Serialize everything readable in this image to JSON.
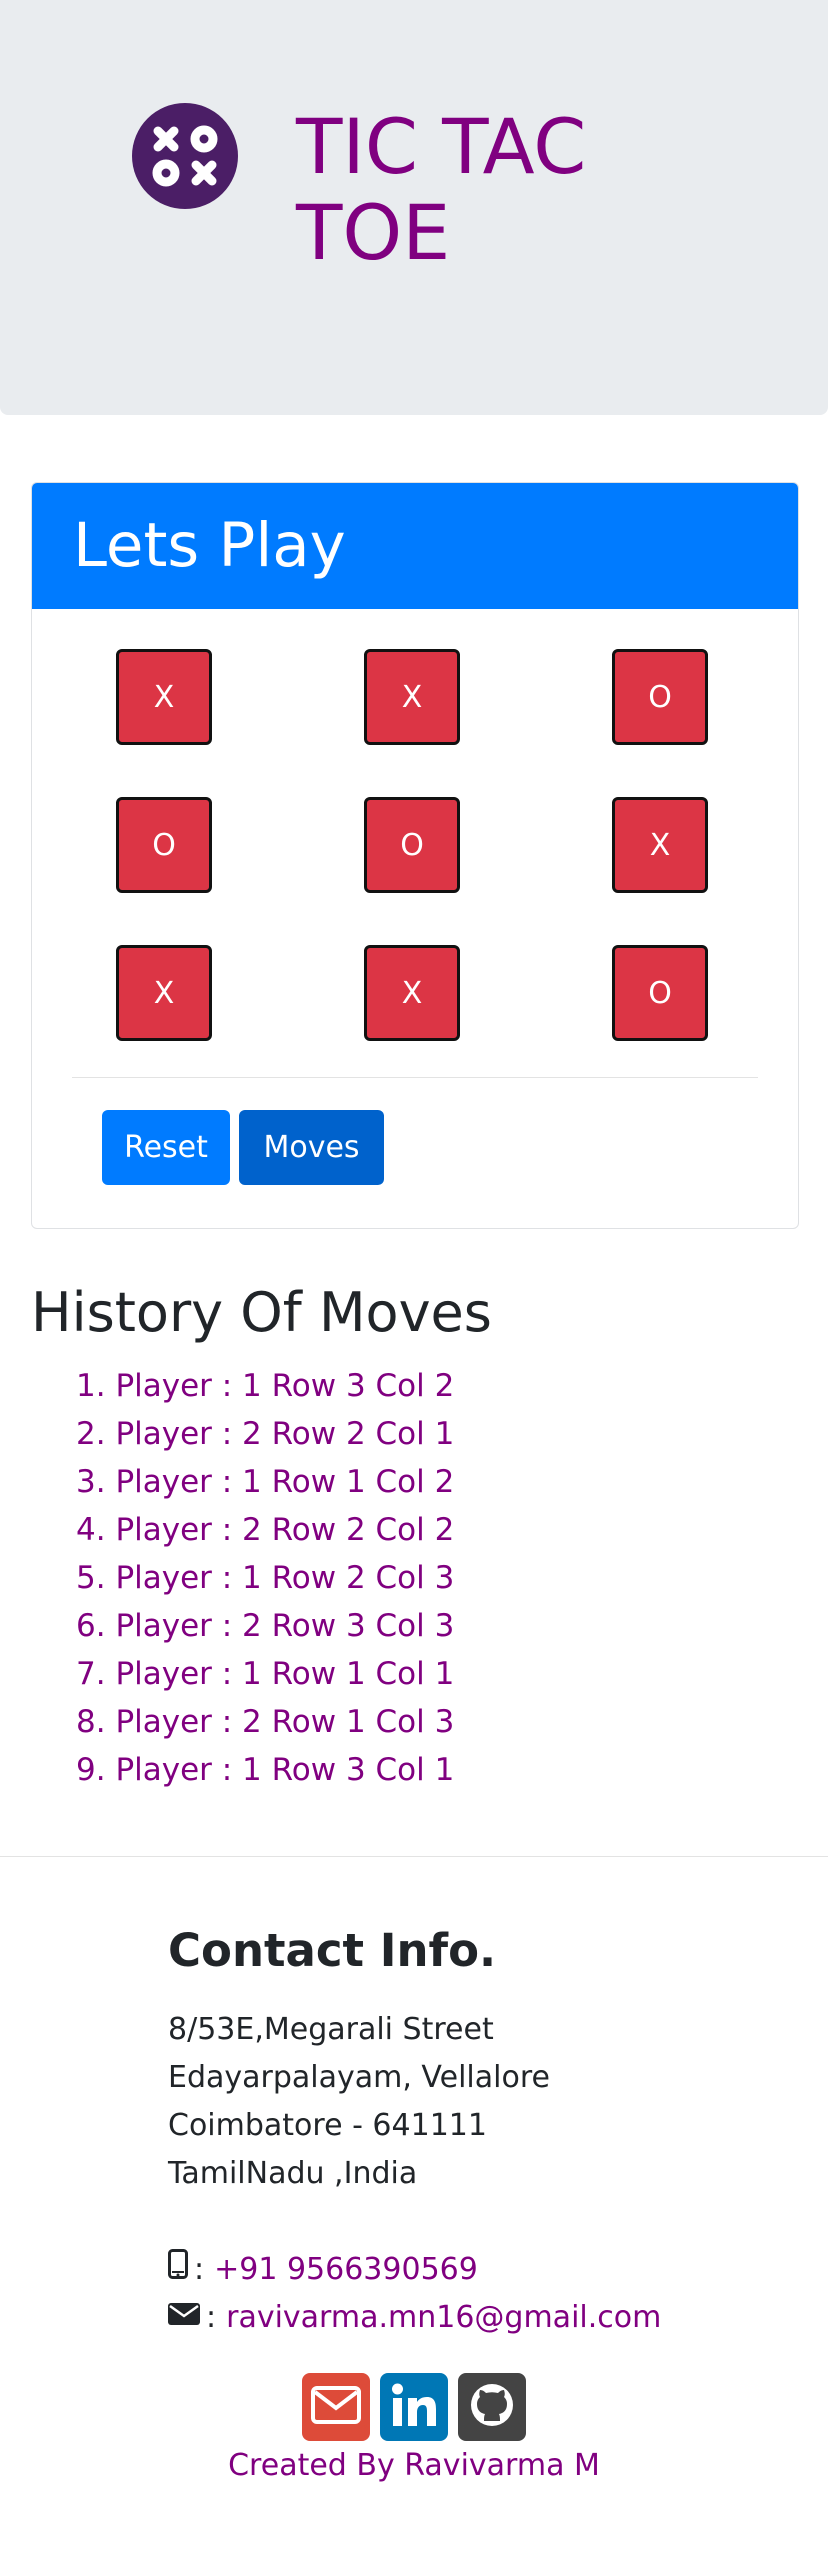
{
  "header": {
    "title_line1": "TIC TAC",
    "title_line2": "TOE",
    "logo_icon": "xo-logo-icon",
    "title_color": "#800080"
  },
  "game": {
    "panel_title": "Lets Play",
    "board": [
      [
        "X",
        "X",
        "O"
      ],
      [
        "O",
        "O",
        "X"
      ],
      [
        "X",
        "X",
        "O"
      ]
    ],
    "reset_label": "Reset",
    "moves_label": "Moves"
  },
  "history": {
    "title": "History Of Moves",
    "moves": [
      "Player : 1 Row 3 Col 2",
      "Player : 2 Row 2 Col 1",
      "Player : 1 Row 1 Col 2",
      "Player : 2 Row 2 Col 2",
      "Player : 1 Row 2 Col 3",
      "Player : 2 Row 3 Col 3",
      "Player : 1 Row 1 Col 1",
      "Player : 2 Row 1 Col 3",
      "Player : 1 Row 3 Col 1"
    ]
  },
  "contact": {
    "title": "Contact Info.",
    "address": [
      "8/53E,Megarali Street",
      "Edayarpalayam, Vellalore",
      "Coimbatore - 641111",
      "TamilNadu ,India"
    ],
    "phone_prefix": ":",
    "phone": "+91 9566390569",
    "email_prefix": ":",
    "email": "ravivarma.mn16@gmail.com",
    "social": [
      {
        "name": "gmail",
        "icon": "mail-icon",
        "color": "#dd4b39"
      },
      {
        "name": "linkedin",
        "icon": "linkedin-icon",
        "color": "#0077b5"
      },
      {
        "name": "github",
        "icon": "github-icon",
        "color": "#333333"
      }
    ],
    "credit": "Created By Ravivarma M"
  },
  "colors": {
    "primary": "#007bff",
    "cell": "#dc3545",
    "accent": "#800080",
    "jumbotron": "#e9ecef"
  }
}
